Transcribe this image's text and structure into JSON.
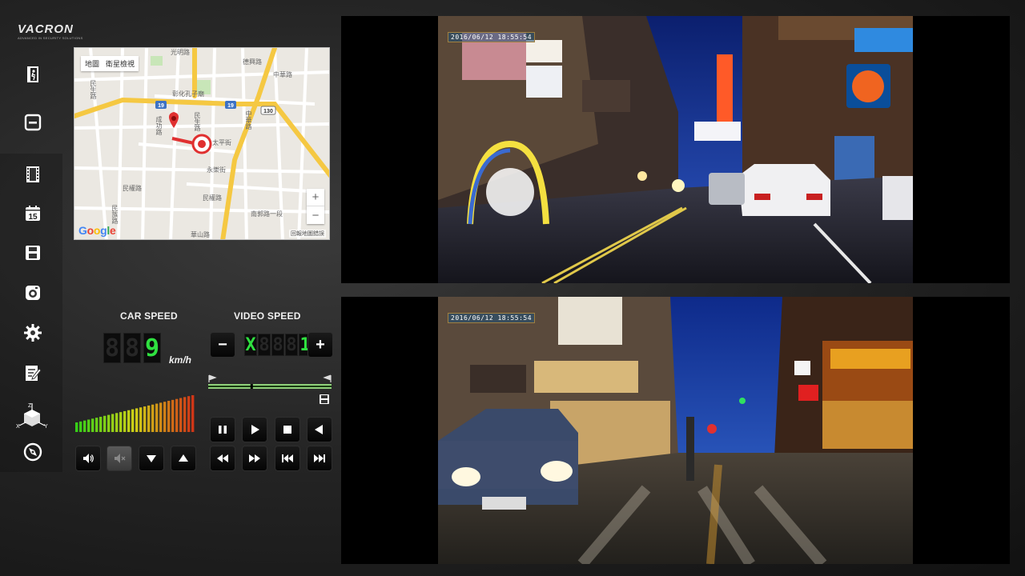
{
  "brand": {
    "name": "VACRON",
    "tagline": "ADVANCED IN SECURITY SOLUTIONS"
  },
  "sidebar": {
    "items": [
      {
        "icon": "exit-icon"
      },
      {
        "icon": "minimize-icon"
      },
      {
        "icon": "film-icon"
      },
      {
        "icon": "calendar-icon",
        "text": "15"
      },
      {
        "icon": "save-icon"
      },
      {
        "icon": "snapshot-icon"
      },
      {
        "icon": "gear-icon"
      },
      {
        "icon": "edit-report-icon"
      },
      {
        "icon": "gsensor-axis-icon",
        "axes": [
          "Z",
          "X",
          "Y"
        ]
      },
      {
        "icon": "compass-icon"
      }
    ]
  },
  "map": {
    "tabs": [
      "地圖",
      "衛星檢視"
    ],
    "zoom_in": "+",
    "zoom_out": "−",
    "credit": "回報地圖錯誤",
    "google": [
      "G",
      "o",
      "o",
      "g",
      "l",
      "e"
    ],
    "road_badges": [
      "19",
      "19",
      "130"
    ],
    "streets": [
      "光明路",
      "德興路",
      "中華路",
      "彰化孔子廟",
      "成功路",
      "民生路",
      "中華路",
      "太平街",
      "永樂街",
      "民權路",
      "民權路",
      "南郭路一段",
      "民族路",
      "華山路",
      "民生路"
    ]
  },
  "car_speed": {
    "label": "CAR SPEED",
    "digits": [
      "8",
      "8",
      "9"
    ],
    "lit": [
      false,
      false,
      true
    ],
    "value": "9",
    "unit": "km/h"
  },
  "video_speed": {
    "label": "VIDEO SPEED",
    "digits": [
      "X",
      "8",
      "8",
      "8",
      "1"
    ],
    "lit": [
      true,
      false,
      false,
      false,
      true
    ],
    "minus": "−",
    "plus": "+"
  },
  "volume": {
    "bars": 30,
    "level_fraction": 1.0
  },
  "playback_progress": 0.35,
  "controls": {
    "audio": [
      "speaker-on-icon",
      "speaker-mute-icon",
      "volume-down-icon",
      "volume-up-icon"
    ],
    "playback": [
      "pause-icon",
      "play-icon",
      "stop-icon",
      "reverse-play-icon",
      "rewind-icon",
      "fast-forward-icon",
      "skip-previous-icon",
      "skip-next-icon"
    ]
  },
  "videos": [
    {
      "name": "front-camera",
      "timestamp": "2016/06/12 18:55:54"
    },
    {
      "name": "rear-camera",
      "timestamp": "2016/06/12 18:55:54"
    }
  ],
  "colors": {
    "digit_on": "#2fe040",
    "digit_off": "#262626",
    "route": "#e03030",
    "road_yellow": "#f5c842"
  }
}
